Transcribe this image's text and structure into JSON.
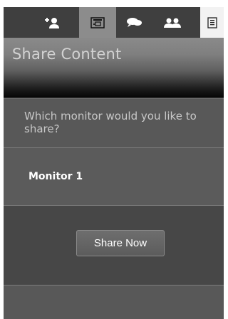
{
  "toolbar": {
    "items": [
      {
        "icon": "add-user-icon",
        "label": ""
      },
      {
        "icon": "share-screen-icon",
        "label": "",
        "active": true
      },
      {
        "icon": "chat-icon",
        "label": ""
      },
      {
        "icon": "participants-icon",
        "label": ""
      },
      {
        "icon": "menu-icon",
        "label": ""
      }
    ]
  },
  "header": {
    "title": "Share Content"
  },
  "question": {
    "text": "Which monitor would you like to share?"
  },
  "options": [
    {
      "label": "Monitor 1"
    }
  ],
  "actions": {
    "share_label": "Share Now"
  },
  "colors": {
    "background": "#4a4a4a",
    "toolbar": "#3f3f3f",
    "active_tab": "#8c8c8c",
    "text_muted": "#c8c8c8"
  }
}
